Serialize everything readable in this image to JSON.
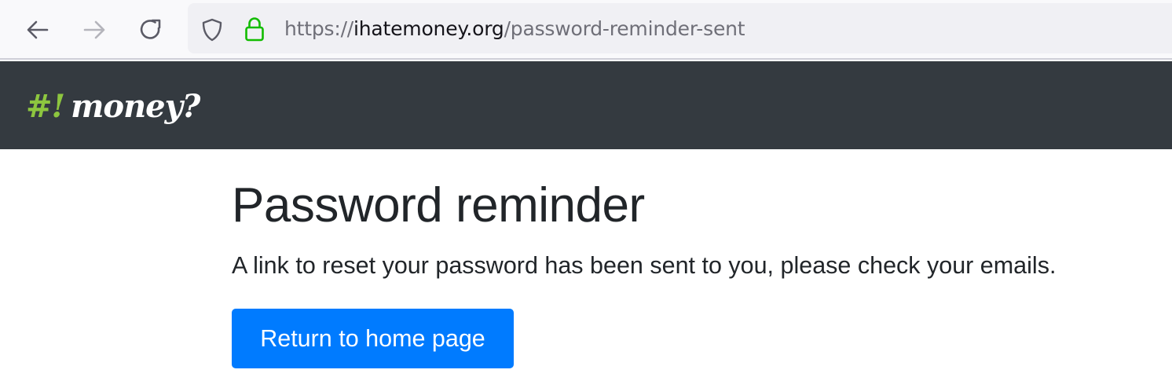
{
  "browser": {
    "url_scheme": "https://",
    "url_domain": "ihatemoney.org",
    "url_path": "/password-reminder-sent",
    "icons": {
      "back": "arrow-left-icon",
      "forward": "arrow-right-icon",
      "reload": "reload-icon",
      "shield": "shield-icon",
      "lock": "lock-icon"
    },
    "colors": {
      "toolbar_bg": "#f9f9fb",
      "urlbar_bg": "#f0f0f4",
      "lock": "#12bc00",
      "url_domain": "#15141a",
      "url_muted": "#6f6f78"
    }
  },
  "navbar": {
    "brand_symbols": "#!",
    "brand_name": "money?",
    "colors": {
      "background": "#343a40",
      "brand_symbols": "#8dc63f",
      "brand_name": "#ffffff"
    }
  },
  "main": {
    "title": "Password reminder",
    "message": "A link to reset your password has been sent to you, please check your emails.",
    "home_button_label": "Return to home page",
    "colors": {
      "text": "#212529",
      "button_bg": "#007bff",
      "button_text": "#ffffff"
    }
  }
}
